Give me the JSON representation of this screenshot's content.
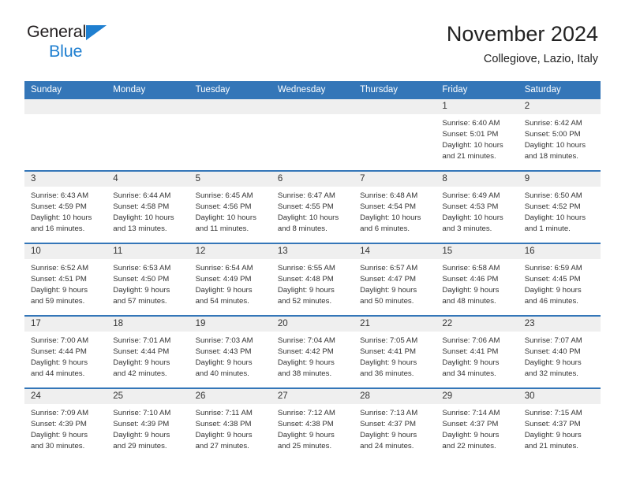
{
  "brand": {
    "name_top": "General",
    "name_bottom": "Blue",
    "triangle_icon": "blue-triangle-icon",
    "accent_color": "#1f7fd0"
  },
  "header": {
    "title": "November 2024",
    "subtitle": "Collegiove, Lazio, Italy"
  },
  "theme": {
    "header_blue": "#3476b8",
    "daynum_gray": "#efefef",
    "text": "#333333"
  },
  "weekdays": [
    "Sunday",
    "Monday",
    "Tuesday",
    "Wednesday",
    "Thursday",
    "Friday",
    "Saturday"
  ],
  "weeks": [
    [
      {
        "day": "",
        "sunrise": "",
        "sunset": "",
        "daylight_line1": "",
        "daylight_line2": ""
      },
      {
        "day": "",
        "sunrise": "",
        "sunset": "",
        "daylight_line1": "",
        "daylight_line2": ""
      },
      {
        "day": "",
        "sunrise": "",
        "sunset": "",
        "daylight_line1": "",
        "daylight_line2": ""
      },
      {
        "day": "",
        "sunrise": "",
        "sunset": "",
        "daylight_line1": "",
        "daylight_line2": ""
      },
      {
        "day": "",
        "sunrise": "",
        "sunset": "",
        "daylight_line1": "",
        "daylight_line2": ""
      },
      {
        "day": "1",
        "sunrise": "Sunrise: 6:40 AM",
        "sunset": "Sunset: 5:01 PM",
        "daylight_line1": "Daylight: 10 hours",
        "daylight_line2": "and 21 minutes."
      },
      {
        "day": "2",
        "sunrise": "Sunrise: 6:42 AM",
        "sunset": "Sunset: 5:00 PM",
        "daylight_line1": "Daylight: 10 hours",
        "daylight_line2": "and 18 minutes."
      }
    ],
    [
      {
        "day": "3",
        "sunrise": "Sunrise: 6:43 AM",
        "sunset": "Sunset: 4:59 PM",
        "daylight_line1": "Daylight: 10 hours",
        "daylight_line2": "and 16 minutes."
      },
      {
        "day": "4",
        "sunrise": "Sunrise: 6:44 AM",
        "sunset": "Sunset: 4:58 PM",
        "daylight_line1": "Daylight: 10 hours",
        "daylight_line2": "and 13 minutes."
      },
      {
        "day": "5",
        "sunrise": "Sunrise: 6:45 AM",
        "sunset": "Sunset: 4:56 PM",
        "daylight_line1": "Daylight: 10 hours",
        "daylight_line2": "and 11 minutes."
      },
      {
        "day": "6",
        "sunrise": "Sunrise: 6:47 AM",
        "sunset": "Sunset: 4:55 PM",
        "daylight_line1": "Daylight: 10 hours",
        "daylight_line2": "and 8 minutes."
      },
      {
        "day": "7",
        "sunrise": "Sunrise: 6:48 AM",
        "sunset": "Sunset: 4:54 PM",
        "daylight_line1": "Daylight: 10 hours",
        "daylight_line2": "and 6 minutes."
      },
      {
        "day": "8",
        "sunrise": "Sunrise: 6:49 AM",
        "sunset": "Sunset: 4:53 PM",
        "daylight_line1": "Daylight: 10 hours",
        "daylight_line2": "and 3 minutes."
      },
      {
        "day": "9",
        "sunrise": "Sunrise: 6:50 AM",
        "sunset": "Sunset: 4:52 PM",
        "daylight_line1": "Daylight: 10 hours",
        "daylight_line2": "and 1 minute."
      }
    ],
    [
      {
        "day": "10",
        "sunrise": "Sunrise: 6:52 AM",
        "sunset": "Sunset: 4:51 PM",
        "daylight_line1": "Daylight: 9 hours",
        "daylight_line2": "and 59 minutes."
      },
      {
        "day": "11",
        "sunrise": "Sunrise: 6:53 AM",
        "sunset": "Sunset: 4:50 PM",
        "daylight_line1": "Daylight: 9 hours",
        "daylight_line2": "and 57 minutes."
      },
      {
        "day": "12",
        "sunrise": "Sunrise: 6:54 AM",
        "sunset": "Sunset: 4:49 PM",
        "daylight_line1": "Daylight: 9 hours",
        "daylight_line2": "and 54 minutes."
      },
      {
        "day": "13",
        "sunrise": "Sunrise: 6:55 AM",
        "sunset": "Sunset: 4:48 PM",
        "daylight_line1": "Daylight: 9 hours",
        "daylight_line2": "and 52 minutes."
      },
      {
        "day": "14",
        "sunrise": "Sunrise: 6:57 AM",
        "sunset": "Sunset: 4:47 PM",
        "daylight_line1": "Daylight: 9 hours",
        "daylight_line2": "and 50 minutes."
      },
      {
        "day": "15",
        "sunrise": "Sunrise: 6:58 AM",
        "sunset": "Sunset: 4:46 PM",
        "daylight_line1": "Daylight: 9 hours",
        "daylight_line2": "and 48 minutes."
      },
      {
        "day": "16",
        "sunrise": "Sunrise: 6:59 AM",
        "sunset": "Sunset: 4:45 PM",
        "daylight_line1": "Daylight: 9 hours",
        "daylight_line2": "and 46 minutes."
      }
    ],
    [
      {
        "day": "17",
        "sunrise": "Sunrise: 7:00 AM",
        "sunset": "Sunset: 4:44 PM",
        "daylight_line1": "Daylight: 9 hours",
        "daylight_line2": "and 44 minutes."
      },
      {
        "day": "18",
        "sunrise": "Sunrise: 7:01 AM",
        "sunset": "Sunset: 4:44 PM",
        "daylight_line1": "Daylight: 9 hours",
        "daylight_line2": "and 42 minutes."
      },
      {
        "day": "19",
        "sunrise": "Sunrise: 7:03 AM",
        "sunset": "Sunset: 4:43 PM",
        "daylight_line1": "Daylight: 9 hours",
        "daylight_line2": "and 40 minutes."
      },
      {
        "day": "20",
        "sunrise": "Sunrise: 7:04 AM",
        "sunset": "Sunset: 4:42 PM",
        "daylight_line1": "Daylight: 9 hours",
        "daylight_line2": "and 38 minutes."
      },
      {
        "day": "21",
        "sunrise": "Sunrise: 7:05 AM",
        "sunset": "Sunset: 4:41 PM",
        "daylight_line1": "Daylight: 9 hours",
        "daylight_line2": "and 36 minutes."
      },
      {
        "day": "22",
        "sunrise": "Sunrise: 7:06 AM",
        "sunset": "Sunset: 4:41 PM",
        "daylight_line1": "Daylight: 9 hours",
        "daylight_line2": "and 34 minutes."
      },
      {
        "day": "23",
        "sunrise": "Sunrise: 7:07 AM",
        "sunset": "Sunset: 4:40 PM",
        "daylight_line1": "Daylight: 9 hours",
        "daylight_line2": "and 32 minutes."
      }
    ],
    [
      {
        "day": "24",
        "sunrise": "Sunrise: 7:09 AM",
        "sunset": "Sunset: 4:39 PM",
        "daylight_line1": "Daylight: 9 hours",
        "daylight_line2": "and 30 minutes."
      },
      {
        "day": "25",
        "sunrise": "Sunrise: 7:10 AM",
        "sunset": "Sunset: 4:39 PM",
        "daylight_line1": "Daylight: 9 hours",
        "daylight_line2": "and 29 minutes."
      },
      {
        "day": "26",
        "sunrise": "Sunrise: 7:11 AM",
        "sunset": "Sunset: 4:38 PM",
        "daylight_line1": "Daylight: 9 hours",
        "daylight_line2": "and 27 minutes."
      },
      {
        "day": "27",
        "sunrise": "Sunrise: 7:12 AM",
        "sunset": "Sunset: 4:38 PM",
        "daylight_line1": "Daylight: 9 hours",
        "daylight_line2": "and 25 minutes."
      },
      {
        "day": "28",
        "sunrise": "Sunrise: 7:13 AM",
        "sunset": "Sunset: 4:37 PM",
        "daylight_line1": "Daylight: 9 hours",
        "daylight_line2": "and 24 minutes."
      },
      {
        "day": "29",
        "sunrise": "Sunrise: 7:14 AM",
        "sunset": "Sunset: 4:37 PM",
        "daylight_line1": "Daylight: 9 hours",
        "daylight_line2": "and 22 minutes."
      },
      {
        "day": "30",
        "sunrise": "Sunrise: 7:15 AM",
        "sunset": "Sunset: 4:37 PM",
        "daylight_line1": "Daylight: 9 hours",
        "daylight_line2": "and 21 minutes."
      }
    ]
  ]
}
